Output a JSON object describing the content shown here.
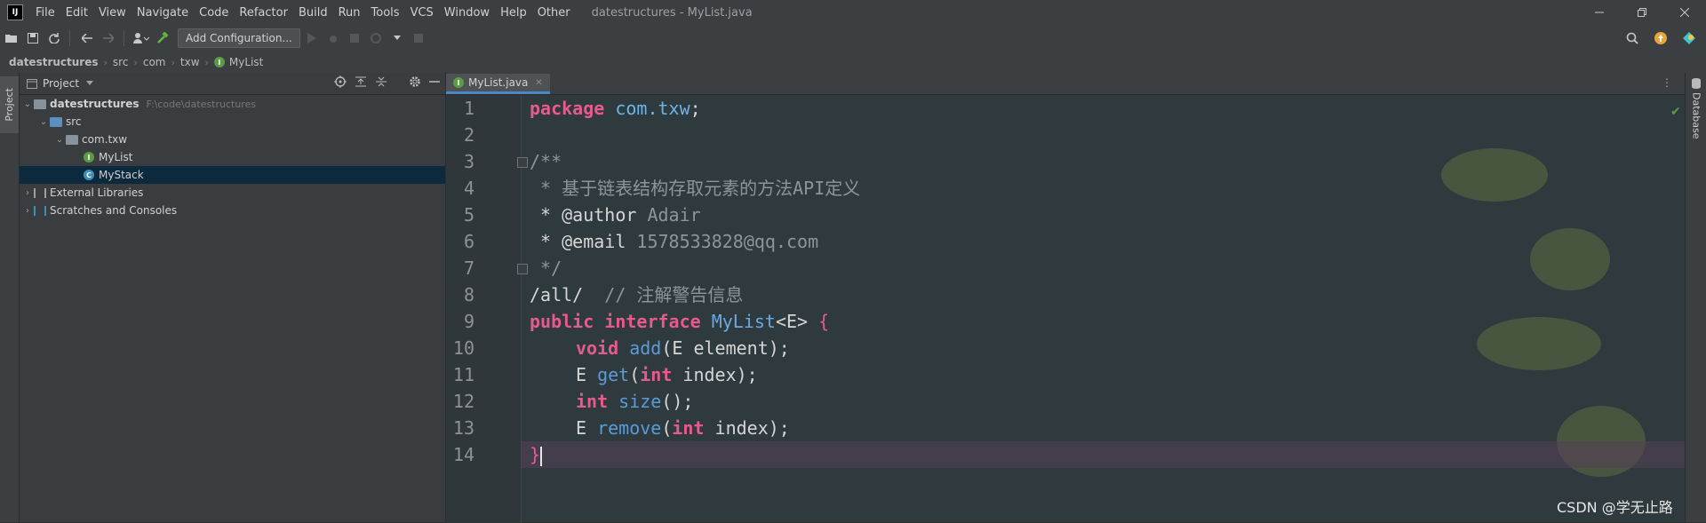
{
  "titlebar": {
    "app_logo": "IJ",
    "menu": [
      "File",
      "Edit",
      "View",
      "Navigate",
      "Code",
      "Refactor",
      "Build",
      "Run",
      "Tools",
      "VCS",
      "Window",
      "Help",
      "Other"
    ],
    "window_title": "datestructures - MyList.java"
  },
  "toolbar": {
    "add_configuration_label": "Add Configuration..."
  },
  "breadcrumb": {
    "items": [
      "datestructures",
      "src",
      "com",
      "txw",
      "MyList"
    ]
  },
  "left_strip": {
    "project_tab": "Project"
  },
  "project_panel": {
    "title": "Project",
    "tree": [
      {
        "label": "datestructures",
        "hint": "F:\\code\\datestructures"
      },
      {
        "label": "src"
      },
      {
        "label": "com.txw"
      },
      {
        "label": "MyList",
        "badge": "I"
      },
      {
        "label": "MyStack",
        "badge": "C"
      },
      {
        "label": "External Libraries"
      },
      {
        "label": "Scratches and Consoles"
      }
    ]
  },
  "editor": {
    "tab_label": "MyList.java",
    "line_numbers": [
      "1",
      "2",
      "3",
      "4",
      "5",
      "6",
      "7",
      "8",
      "9",
      "10",
      "11",
      "12",
      "13",
      "14"
    ],
    "code": {
      "l1_kw": "package",
      "l1_pkg": "com.txw",
      "l1_end": ";",
      "l3": "/**",
      "l4": " * 基于链表结构存取元素的方法API定义",
      "l5_tag": " * @author",
      "l5_val": " Adair",
      "l6_tag": " * @email",
      "l6_val": " 1578533828@qq.com",
      "l7": " */",
      "l8_code": "/all/",
      "l8_cmt": "  // 注解警告信息",
      "l9_kw": "public interface",
      "l9_cls": " MyList",
      "l9_gen": "<E> ",
      "l9_brace": "{",
      "l10_kw": "void",
      "l10_fn": " add",
      "l10_rest": "(E element);",
      "l11_a": "E",
      "l11_fn": " get",
      "l11_paren": "(",
      "l11_kw": "int",
      "l11_rest": " index);",
      "l12_kw": "int",
      "l12_fn": " size",
      "l12_rest": "();",
      "l13_a": "E",
      "l13_fn": " remove",
      "l13_paren": "(",
      "l13_kw": "int",
      "l13_rest": " index);",
      "l14": "}"
    }
  },
  "right_strip": {
    "database_tab": "Database"
  },
  "watermark": "CSDN @学无止路"
}
